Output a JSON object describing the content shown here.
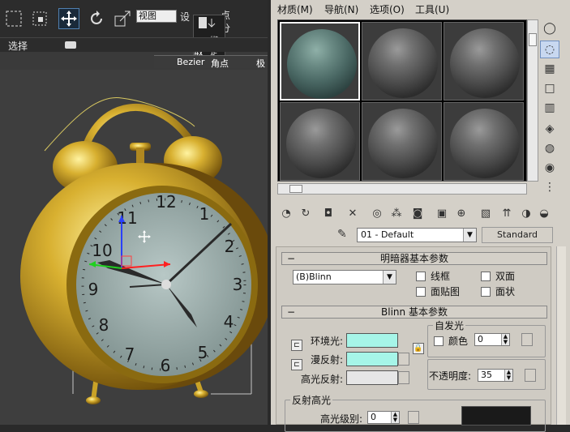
{
  "toolbar": {
    "view_dropdown": "视图",
    "cut_labels": [
      "设",
      "点",
      "分",
      "绑定",
      "取",
      "角点",
      "极"
    ]
  },
  "select_bar": {
    "label": "选择"
  },
  "bezier_bar": {
    "label": "Bezier",
    "corner": "角点",
    "extra": "极"
  },
  "viewport": {
    "clock_numbers": [
      "12",
      "1",
      "2",
      "3",
      "4",
      "5",
      "6",
      "7",
      "8",
      "9",
      "10",
      "11"
    ]
  },
  "menu": {
    "items": [
      "材质(M)",
      "导航(N)",
      "选项(O)",
      "工具(U)"
    ]
  },
  "material": {
    "name": "01 - Default",
    "type_button": "Standard"
  },
  "shader_rollout": {
    "title": "明暗器基本参数",
    "shader": "(B)Blinn",
    "wire": "线框",
    "two_sided": "双面",
    "face_map": "面贴图",
    "faceted": "面状"
  },
  "blinn_rollout": {
    "title": "Blinn 基本参数",
    "self_illum_title": "自发光",
    "color_label": "颜色",
    "color_value": "0",
    "ambient_label": "环境光:",
    "diffuse_label": "漫反射:",
    "specular_label": "高光反射:",
    "opacity_label": "不透明度:",
    "opacity_value": "35",
    "spec_highlights_title": "反射高光",
    "spec_level_label": "高光级别:",
    "spec_level_value": "0"
  },
  "colors": {
    "ambient": "#a6f5e8",
    "diffuse": "#a6f5e8",
    "specular": "#e6e6e6",
    "viewport_bg": "#3e3e3e",
    "clock_gold": "#c9a227"
  }
}
